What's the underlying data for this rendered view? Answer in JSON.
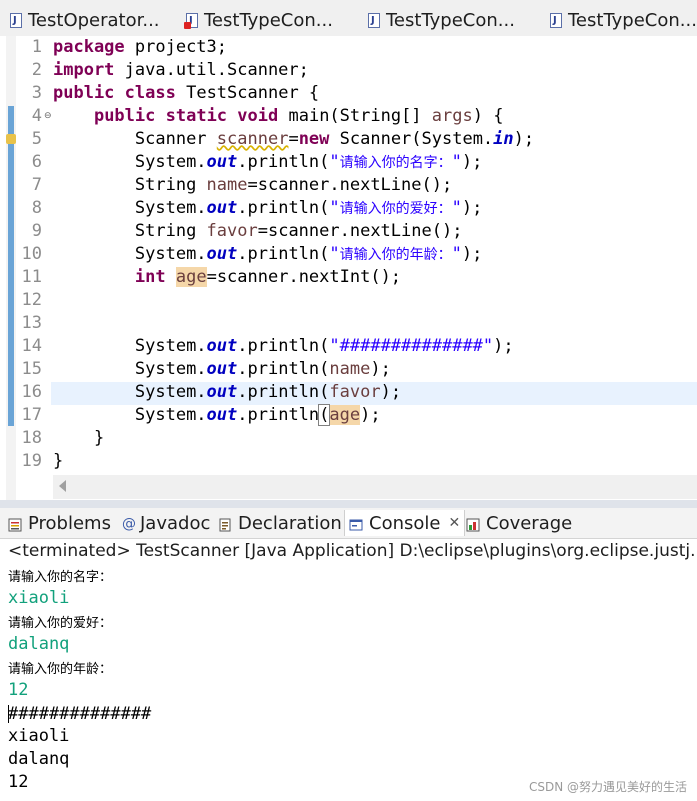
{
  "editor_tabs": [
    {
      "label": "TestOperator..."
    },
    {
      "label": "TestTypeCon..."
    },
    {
      "label": "TestTypeCon..."
    },
    {
      "label": "TestTypeCon..."
    }
  ],
  "code": {
    "line_numbers": [
      "1",
      "2",
      "3",
      "4",
      "5",
      "6",
      "7",
      "8",
      "9",
      "10",
      "11",
      "12",
      "13",
      "14",
      "15",
      "16",
      "17",
      "18",
      "19"
    ],
    "l1": {
      "kw": "package",
      "rest": " project3;"
    },
    "l2": {
      "kw": "import",
      "rest": " java.util.Scanner;"
    },
    "l3": {
      "kw1": "public",
      "kw2": "class",
      "rest": " TestScanner {"
    },
    "l4": {
      "indent": "    ",
      "kw1": "public",
      "kw2": "static",
      "kw3": "void",
      "a": " main(String[] ",
      "param": "args",
      "b": ") {"
    },
    "l5": {
      "indent": "        ",
      "a": "Scanner ",
      "var": "scanner",
      "eq": "=",
      "kw": "new",
      "b": " Scanner(System.",
      "fld": "in",
      "c": ");"
    },
    "l6": {
      "indent": "        ",
      "a": "System.",
      "fld": "out",
      "b": ".println(",
      "q1": "\"",
      "cjk": "请输入你的名字：",
      "q2": "\"",
      "c": ");"
    },
    "l7": {
      "indent": "        ",
      "a": "String ",
      "var": "name",
      "b": "=scanner.nextLine();"
    },
    "l8": {
      "indent": "        ",
      "a": "System.",
      "fld": "out",
      "b": ".println(",
      "q1": "\"",
      "cjk": "请输入你的爱好：",
      "q2": "\"",
      "c": ");"
    },
    "l9": {
      "indent": "        ",
      "a": "String ",
      "var": "favor",
      "b": "=scanner.nextLine();"
    },
    "l10": {
      "indent": "        ",
      "a": "System.",
      "fld": "out",
      "b": ".println(",
      "q1": "\"",
      "cjk": "请输入你的年龄：",
      "q2": "\"",
      "c": ");"
    },
    "l11": {
      "indent": "        ",
      "kw": "int",
      "sp": " ",
      "var": "age",
      "b": "=scanner.nextInt();"
    },
    "l13": {
      "indent": "        ",
      "a": "System.",
      "fld": "out",
      "b": ".println(",
      "str": "\"##############\"",
      "c": ");"
    },
    "l14": {
      "indent": "        ",
      "a": "System.",
      "fld": "out",
      "b": ".println(",
      "var": "name",
      "c": ");"
    },
    "l15": {
      "indent": "        ",
      "a": "System.",
      "fld": "out",
      "b": ".println(",
      "var": "favor",
      "c": ");"
    },
    "l16": {
      "indent": "        ",
      "a": "System.",
      "fld": "out",
      "b": ".println",
      "paren": "(",
      "var": "age",
      "c": ");"
    },
    "l17": {
      "text": "    }"
    },
    "l18": {
      "text": "}"
    }
  },
  "view_tabs": [
    {
      "label": "Problems"
    },
    {
      "label": "Javadoc"
    },
    {
      "label": "Declaration"
    },
    {
      "label": "Console",
      "close": "✕"
    },
    {
      "label": "Coverage"
    }
  ],
  "status": "<terminated> TestScanner [Java Application] D:\\eclipse\\plugins\\org.eclipse.justj.",
  "console_output": [
    {
      "text": "请输入你的名字：",
      "kind": "prompt"
    },
    {
      "text": "xiaoli",
      "kind": "input"
    },
    {
      "text": "请输入你的爱好：",
      "kind": "prompt"
    },
    {
      "text": "dalanq",
      "kind": "input"
    },
    {
      "text": "请输入你的年龄：",
      "kind": "prompt"
    },
    {
      "text": "12",
      "kind": "input"
    },
    {
      "text": "##############",
      "kind": "output"
    },
    {
      "text": "xiaoli",
      "kind": "output"
    },
    {
      "text": "dalanq",
      "kind": "output"
    },
    {
      "text": "12",
      "kind": "output"
    }
  ],
  "watermark": "CSDN @努力遇见美好的生活",
  "colors": {
    "keyword": "#7f0055",
    "field": "#0000c0",
    "string": "#2a00ff",
    "input": "#12a17c",
    "current_line": "#e8f2fe"
  }
}
